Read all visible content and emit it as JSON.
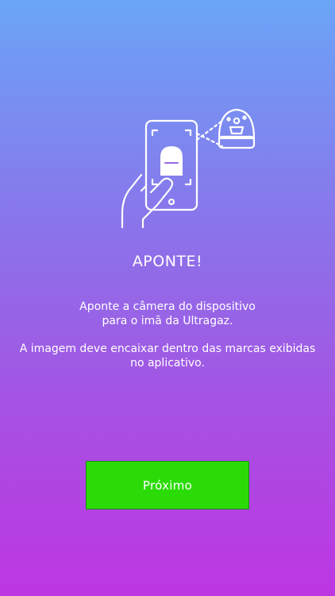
{
  "illustration": {
    "icon": "hand-phone-scan-magnet-icon"
  },
  "content": {
    "title": "APONTE!",
    "instruction_line_1": "Aponte a câmera do dispositivo",
    "instruction_line_2": "para o imã da Ultragaz.",
    "hint_line_1": "A imagem deve encaixar dentro das marcas exibidas",
    "hint_line_2": "no aplicativo."
  },
  "actions": {
    "next_label": "Próximo"
  },
  "colors": {
    "gradient_top": "#6aa5f7",
    "gradient_bottom": "#bd36e2",
    "button_green": "#2bdb08"
  }
}
